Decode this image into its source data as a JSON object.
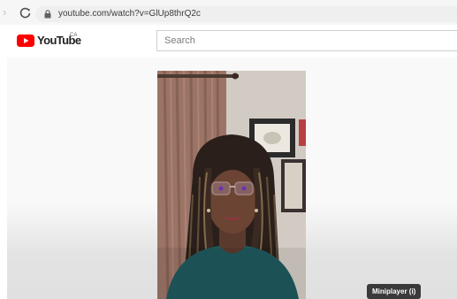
{
  "browser": {
    "url": "youtube.com/watch?v=GlUp8thrQ2c"
  },
  "header": {
    "logo_text": "YouTube",
    "country_code": "CA",
    "search_placeholder": "Search"
  },
  "player": {
    "miniplayer_tooltip": "Miniplayer (i)"
  },
  "colors": {
    "brand_red": "#ff0000",
    "tooltip_bg": "#3a3a3a"
  }
}
